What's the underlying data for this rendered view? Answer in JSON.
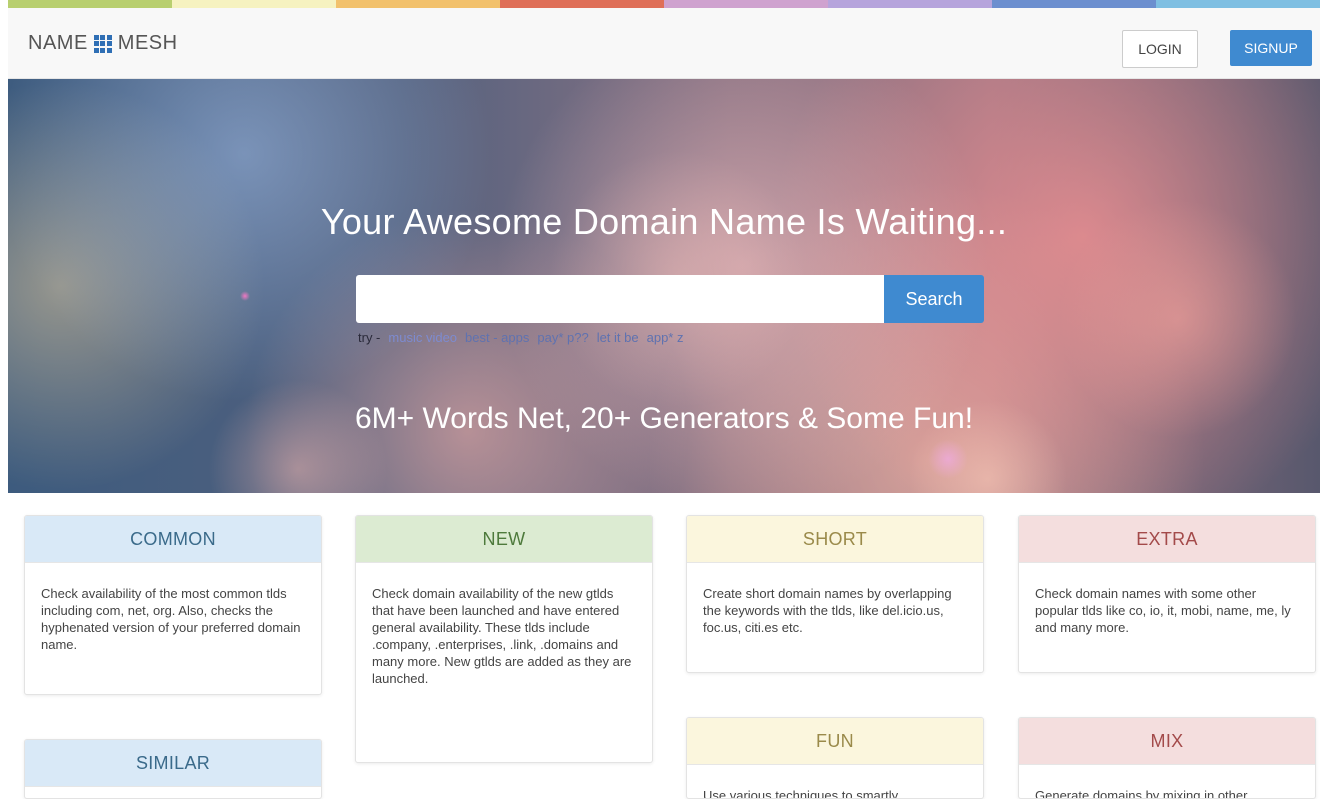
{
  "strip_colors": [
    "#b8cf6f",
    "#f6f2c0",
    "#f2c16c",
    "#df6f58",
    "#cfa2cf",
    "#b6a4dc",
    "#6c8fcf",
    "#7fbfe2"
  ],
  "logo": {
    "text_left": "NAME",
    "text_right": "MESH",
    "icon": "grid-icon"
  },
  "nav": {
    "login": "LOGIN",
    "signup": "SIGNUP"
  },
  "hero": {
    "title": "Your Awesome Domain Name Is Waiting...",
    "search_value": "",
    "search_button": "Search",
    "try_label": "try -",
    "examples": [
      "music video",
      "best - apps",
      "pay* p??",
      "let it be",
      "app* z"
    ],
    "subtitle": "6M+ Words Net, 20+ Generators & Some Fun!"
  },
  "cards": [
    {
      "title": "COMMON",
      "color": "#d9e9f7",
      "text_color": "#3a6a8a",
      "text": "Check availability of the most common tlds including com, net, org. Also, checks the hyphenated version of your preferred domain name."
    },
    {
      "title": "NEW",
      "color": "#dcebd2",
      "text_color": "#4e7a3c",
      "text": "Check domain availability of the new gtlds that have been launched and have entered general availability. These tlds include .company, .enterprises, .link, .domains and many more. New gtlds are added as they are launched."
    },
    {
      "title": "SHORT",
      "color": "#fbf6dd",
      "text_color": "#9a8a4a",
      "text": "Create short domain names by overlapping the keywords with the tlds, like del.icio.us, foc.us, citi.es etc."
    },
    {
      "title": "EXTRA",
      "color": "#f4dede",
      "text_color": "#a34a4a",
      "text": "Check domain names with some other popular tlds like co, io, it, mobi, name, me, ly and many more."
    },
    {
      "title": "SIMILAR",
      "color": "#d9e9f7",
      "text_color": "#3a6a8a",
      "text": ""
    },
    {
      "title": "FUN",
      "color": "#fbf6dd",
      "text_color": "#9a8a4a",
      "text": "Use various techniques to smartly"
    },
    {
      "title": "MIX",
      "color": "#f4dede",
      "text_color": "#a34a4a",
      "text": "Generate domains by mixing in other"
    }
  ]
}
